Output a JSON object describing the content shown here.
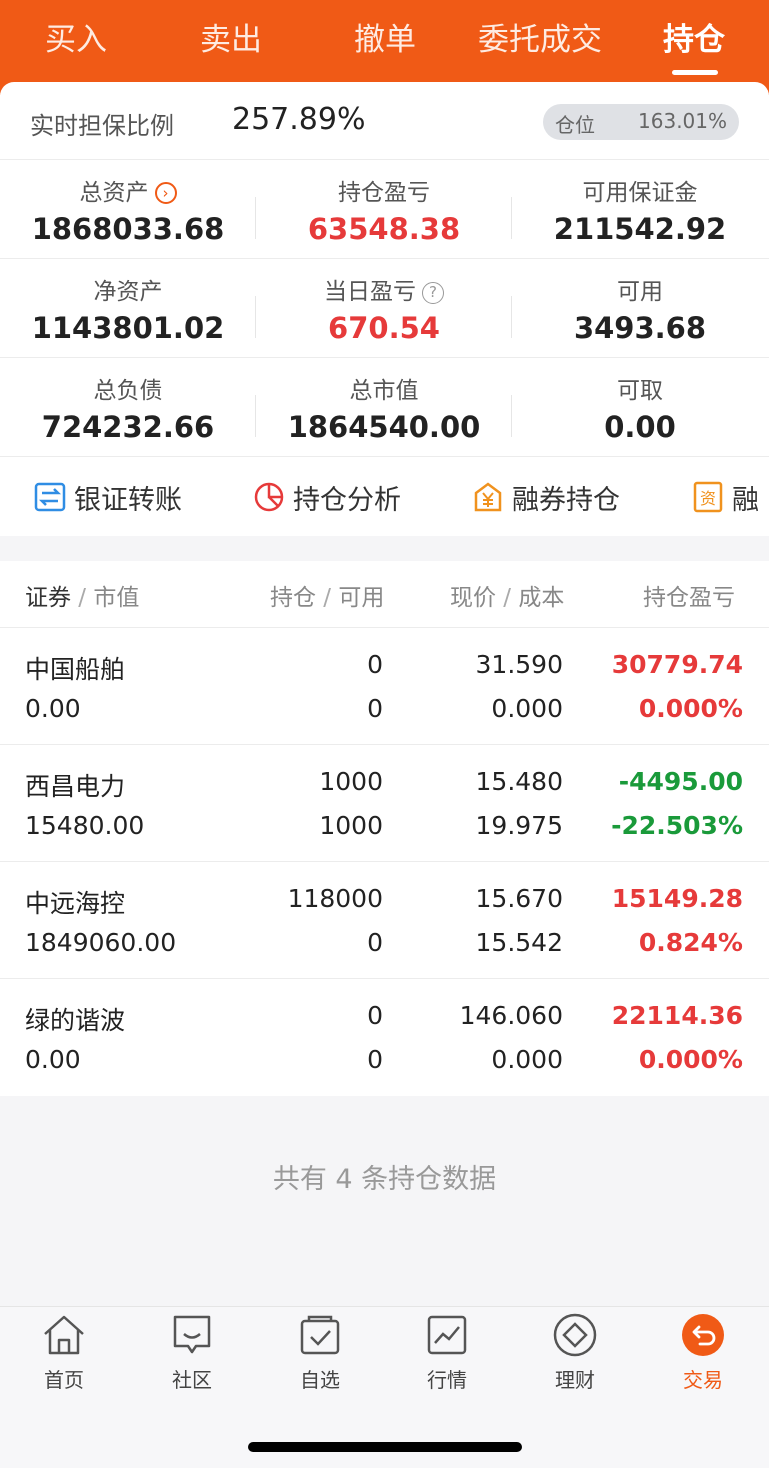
{
  "tabs": [
    "买入",
    "卖出",
    "撤单",
    "委托成交",
    "持仓"
  ],
  "active_tab": "持仓",
  "ratio": {
    "label": "实时担保比例",
    "value": "257.89%",
    "position_label": "仓位",
    "position_value": "163.01%"
  },
  "summary": [
    {
      "label": "总资产",
      "value": "1868033.68",
      "color": "normal",
      "icon": "arrow-circle-icon"
    },
    {
      "label": "持仓盈亏",
      "value": "63548.38",
      "color": "red"
    },
    {
      "label": "可用保证金",
      "value": "211542.92",
      "color": "normal"
    },
    {
      "label": "净资产",
      "value": "1143801.02",
      "color": "normal"
    },
    {
      "label": "当日盈亏",
      "value": "670.54",
      "color": "red",
      "icon": "question-icon"
    },
    {
      "label": "可用",
      "value": "3493.68",
      "color": "normal"
    },
    {
      "label": "总负债",
      "value": "724232.66",
      "color": "normal"
    },
    {
      "label": "总市值",
      "value": "1864540.00",
      "color": "normal"
    },
    {
      "label": "可取",
      "value": "0.00",
      "color": "normal"
    }
  ],
  "actions": [
    "银证转账",
    "持仓分析",
    "融券持仓",
    "融"
  ],
  "table": {
    "headers": {
      "security": "证券",
      "market_value": "市值",
      "position": "持仓",
      "available": "可用",
      "price": "现价",
      "cost": "成本",
      "pnl": "持仓盈亏"
    },
    "rows": [
      {
        "name": "中国船舶",
        "market_value": "0.00",
        "position": "0",
        "available": "0",
        "price": "31.590",
        "cost": "0.000",
        "pnl": "30779.74",
        "pnl_pct": "0.000%",
        "trend": "up"
      },
      {
        "name": "西昌电力",
        "market_value": "15480.00",
        "position": "1000",
        "available": "1000",
        "price": "15.480",
        "cost": "19.975",
        "pnl": "-4495.00",
        "pnl_pct": "-22.503%",
        "trend": "down"
      },
      {
        "name": "中远海控",
        "market_value": "1849060.00",
        "position": "118000",
        "available": "0",
        "price": "15.670",
        "cost": "15.542",
        "pnl": "15149.28",
        "pnl_pct": "0.824%",
        "trend": "up"
      },
      {
        "name": "绿的谐波",
        "market_value": "0.00",
        "position": "0",
        "available": "0",
        "price": "146.060",
        "cost": "0.000",
        "pnl": "22114.36",
        "pnl_pct": "0.000%",
        "trend": "up"
      }
    ]
  },
  "footer_note": "共有 4 条持仓数据",
  "nav": [
    {
      "label": "首页",
      "icon": "home-icon"
    },
    {
      "label": "社区",
      "icon": "chat-icon"
    },
    {
      "label": "自选",
      "icon": "watchlist-icon"
    },
    {
      "label": "行情",
      "icon": "chart-icon"
    },
    {
      "label": "理财",
      "icon": "diamond-icon"
    },
    {
      "label": "交易",
      "icon": "trade-icon",
      "active": true
    }
  ],
  "colors": {
    "brand": "#f05a16",
    "up": "#e63a3a",
    "down": "#1a9a3a"
  }
}
